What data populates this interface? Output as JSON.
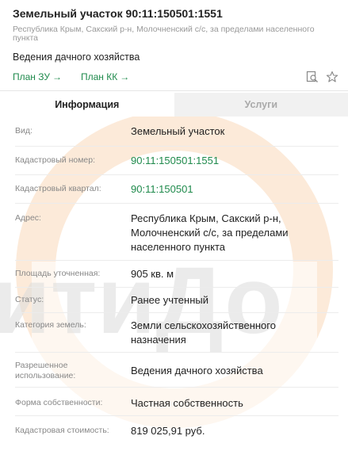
{
  "header": {
    "title": "Земельный участок 90:11:150501:1551",
    "address_line": "Республика Крым, Сакский р-н, Молочненский с/с, за пределами населенного пункта",
    "purpose": "Ведения дачного хозяйства"
  },
  "links": {
    "plan_zu": "План ЗУ",
    "plan_kk": "План КК",
    "arrow": "→"
  },
  "icons": {
    "search": "search-in-document-icon",
    "favorite": "star-outline-icon"
  },
  "tabs": [
    {
      "label": "Информация",
      "active": true
    },
    {
      "label": "Услуги",
      "active": false
    }
  ],
  "watermark": {
    "text": "итиДо"
  },
  "colors": {
    "accent": "#1f8a4c",
    "label": "#888888",
    "watermark": "#f6c59a"
  },
  "rows": [
    {
      "label": "Вид:",
      "value": "Земельный участок"
    },
    {
      "label": "Кадастровый номер:",
      "value": "90:11:150501:1551"
    },
    {
      "label": "Кадастровый квартал:",
      "value": "90:11:150501"
    },
    {
      "label": "Адрес:",
      "value": "Республика Крым, Сакский р-н, Молочненский с/с, за пределами населенного пункта"
    },
    {
      "label": "Площадь уточненная:",
      "value": "905 кв. м"
    },
    {
      "label": "Статус:",
      "value": "Ранее учтенный"
    },
    {
      "label": "Категория земель:",
      "value": "Земли сельскохозяйственного назначения"
    },
    {
      "label": "Разрешенное использование:",
      "value": "Ведения дачного хозяйства"
    },
    {
      "label": "Форма собственности:",
      "value": "Частная собственность"
    },
    {
      "label": "Кадастровая стоимость:",
      "value": "819 025,91 руб."
    }
  ]
}
